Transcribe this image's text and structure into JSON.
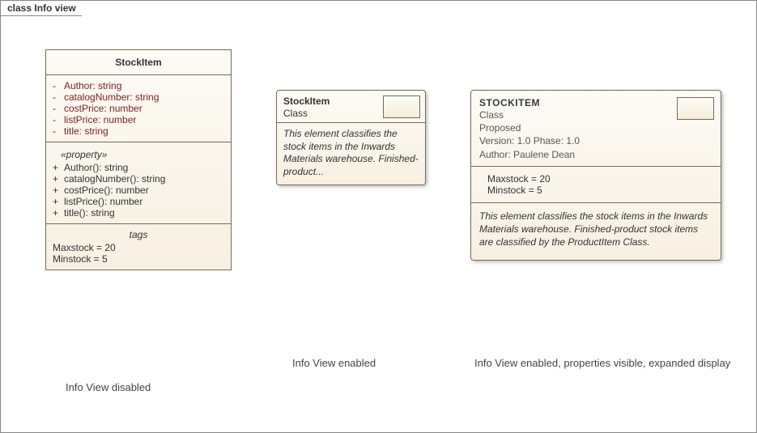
{
  "frame_title": "class Info view",
  "uml": {
    "name": "StockItem",
    "attributes": [
      {
        "vis": "-",
        "text": "Author: string"
      },
      {
        "vis": "-",
        "text": "catalogNumber: string"
      },
      {
        "vis": "-",
        "text": "costPrice: number"
      },
      {
        "vis": "-",
        "text": "listPrice: number"
      },
      {
        "vis": "-",
        "text": "title: string"
      }
    ],
    "stereotype": "«property»",
    "operations": [
      {
        "vis": "+",
        "text": "Author(): string"
      },
      {
        "vis": "+",
        "text": "catalogNumber(): string"
      },
      {
        "vis": "+",
        "text": "costPrice(): number"
      },
      {
        "vis": "+",
        "text": "listPrice(): number"
      },
      {
        "vis": "+",
        "text": "title(): string"
      }
    ],
    "tags_label": "tags",
    "tags": [
      "Maxstock = 20",
      "Minstock = 5"
    ]
  },
  "info_simple": {
    "name": "StockItem",
    "kind": "Class",
    "desc": "This element classifies the stock items in the Inwards Materials warehouse. Finished-product..."
  },
  "info_expanded": {
    "name": "STOCKITEM",
    "kind": "Class",
    "status": "Proposed",
    "version_line": "Version: 1.0 Phase: 1.0",
    "author_line": "Author: Paulene Dean",
    "props": [
      "Maxstock = 20",
      "Minstock = 5"
    ],
    "desc": "This element classifies the stock items in the Inwards Materials warehouse. Finished-product stock items are classified by the ProductItem Class."
  },
  "captions": {
    "disabled": "Info View disabled",
    "enabled": "Info View enabled",
    "expanded": "Info View enabled, properties visible, expanded display"
  }
}
